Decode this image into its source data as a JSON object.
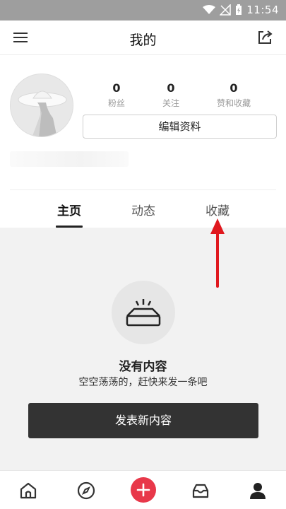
{
  "status_bar": {
    "time": "11:54"
  },
  "header": {
    "title": "我的"
  },
  "profile": {
    "stats": [
      {
        "value": "0",
        "label": "粉丝"
      },
      {
        "value": "0",
        "label": "关注"
      },
      {
        "value": "0",
        "label": "赞和收藏"
      }
    ],
    "edit_button_label": "编辑资料"
  },
  "tabs": [
    {
      "label": "主页",
      "active": true
    },
    {
      "label": "动态",
      "active": false
    },
    {
      "label": "收藏",
      "active": false
    }
  ],
  "empty_state": {
    "title": "没有内容",
    "subtitle": "空空荡荡的，赶快来发一条吧",
    "button_label": "发表新内容"
  },
  "bottom_nav": [
    {
      "icon": "home-icon"
    },
    {
      "icon": "compass-icon"
    },
    {
      "icon": "plus-icon"
    },
    {
      "icon": "inbox-icon"
    },
    {
      "icon": "user-icon"
    }
  ],
  "colors": {
    "accent": "#e8384a",
    "dark_button": "#333333",
    "annotation_arrow": "#e0181e"
  }
}
